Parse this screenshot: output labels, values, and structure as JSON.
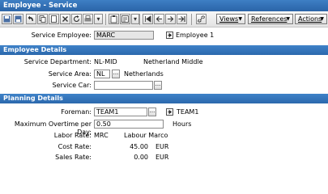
{
  "window": {
    "title": "Employee - Service"
  },
  "toolbar": {
    "views_label": "Views",
    "references_label": "References",
    "actions_label": "Actions",
    "icons": [
      "save-icon",
      "save-close-icon",
      "undo-icon",
      "copy-icon",
      "new-icon",
      "delete-icon",
      "refresh-icon",
      "print-icon",
      "clipboard-icon",
      "find-icon",
      "attach-icon",
      "first-record-icon",
      "previous-record-icon",
      "next-record-icon",
      "last-record-icon",
      "link-icon"
    ]
  },
  "header": {
    "service_employee_label": "Service Employee:",
    "service_employee_value": "MARC",
    "service_employee_name": "Employee 1"
  },
  "employee_details": {
    "title": "Employee Details",
    "department_label": "Service Department:",
    "department_code": "NL-MID",
    "department_name": "Netherland Middle",
    "area_label": "Service Area:",
    "area_code": "NL",
    "area_name": "Netherlands",
    "car_label": "Service Car:",
    "car_value": ""
  },
  "planning_details": {
    "title": "Planning Details",
    "foreman_label": "Foreman:",
    "foreman_value": "TEAM1",
    "foreman_name": "TEAM1",
    "overtime_label": "Maximum Overtime per Day:",
    "overtime_value": "0.50",
    "overtime_unit": "Hours",
    "labor_rate_label": "Labor Rate:",
    "labor_rate_code": "MRC",
    "labor_rate_name": "Labour Marco",
    "cost_rate_label": "Cost Rate:",
    "cost_rate_value": "45.00",
    "cost_rate_currency": "EUR",
    "sales_rate_label": "Sales Rate:",
    "sales_rate_value": "0.00",
    "sales_rate_currency": "EUR"
  },
  "lookup_button_label": "...",
  "colors": {
    "header_blue": "#2b68ad",
    "readonly_field": "#e6e6e6"
  }
}
